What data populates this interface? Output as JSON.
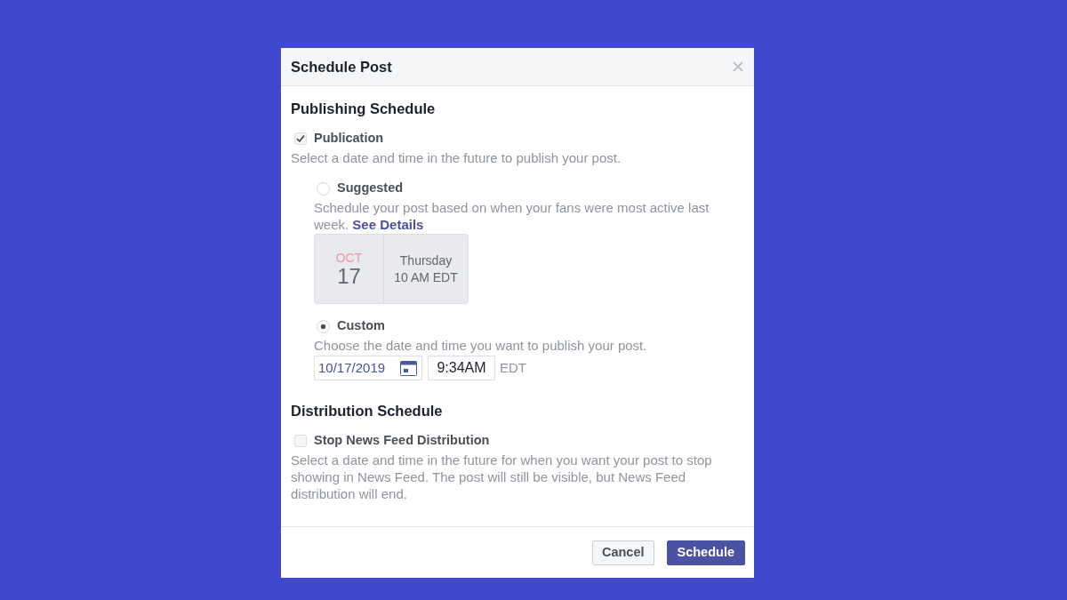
{
  "dialog": {
    "title": "Schedule Post"
  },
  "publishing": {
    "heading": "Publishing Schedule",
    "publication": {
      "label": "Publication",
      "checked": true,
      "description": "Select a date and time in the future to publish your post."
    },
    "options": [
      {
        "kind": "suggested",
        "label": "Suggested",
        "selected": false,
        "description": "Schedule your post based on when your fans were most active last week.",
        "link": "See Details",
        "card": {
          "month": "OCT",
          "day": "17",
          "weekday": "Thursday",
          "time": "10 AM EDT"
        }
      },
      {
        "kind": "custom",
        "label": "Custom",
        "selected": true,
        "description": "Choose the date and time you want to publish your post.",
        "date": "10/17/2019",
        "time": "9:34AM",
        "timezone": "EDT"
      }
    ]
  },
  "distribution": {
    "heading": "Distribution Schedule",
    "stop": {
      "label": "Stop News Feed Distribution",
      "checked": false,
      "description": "Select a date and time in the future for when you want your post to stop showing in News Feed. The post will still be visible, but News Feed distribution will end."
    }
  },
  "footer": {
    "buttons": [
      {
        "label": "Cancel",
        "kind": "secondary"
      },
      {
        "label": "Schedule",
        "kind": "primary"
      }
    ]
  }
}
